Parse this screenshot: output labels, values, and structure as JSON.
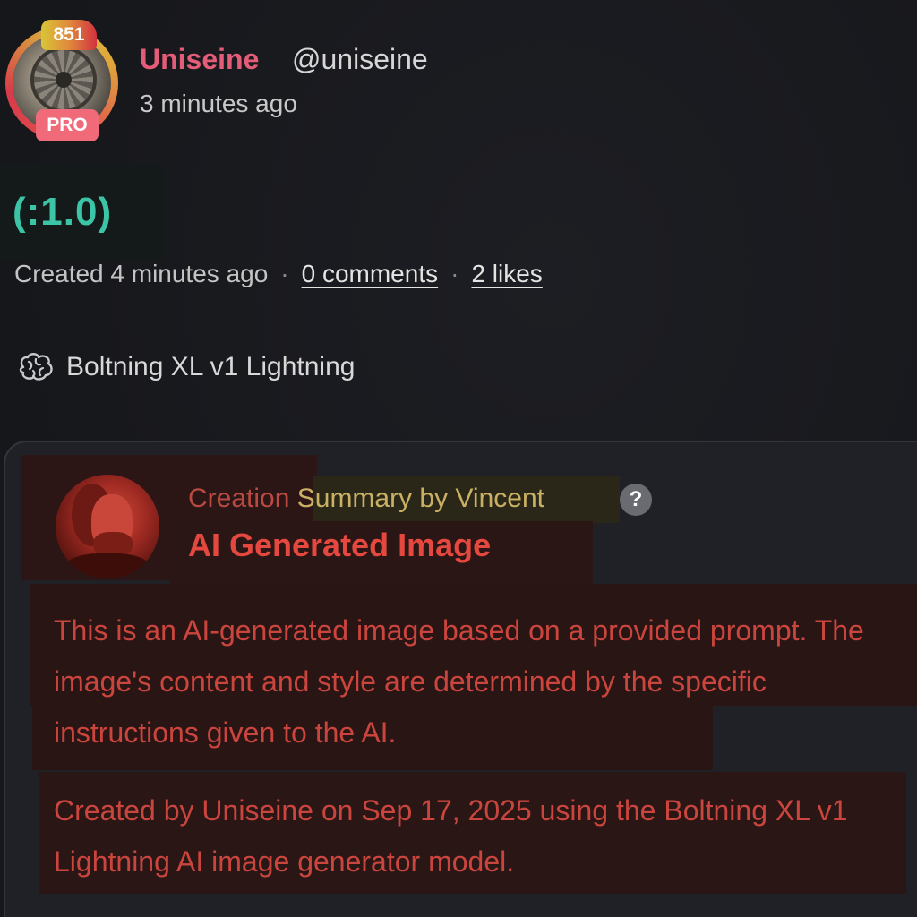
{
  "author": {
    "name": "Uniseine",
    "handle": "@uniseine",
    "time": "3 minutes ago",
    "level": "851",
    "badge": "PRO"
  },
  "post": {
    "strength": "(:1.0)",
    "created": "Created 4 minutes ago",
    "separator": "·",
    "comments": "0 comments",
    "likes": "2 likes"
  },
  "model": {
    "icon": "brain-icon",
    "name": "Boltning XL v1 Lightning"
  },
  "summary": {
    "label_part1": "Creation",
    "label_part2": "Summary by Vincent",
    "help": "?",
    "title": "AI Generated Image",
    "paragraph1": "This is an AI-generated image based on a provided prompt. The image's content and style are determined by the specific instructions given to the AI.",
    "paragraph2": "Created by Uniseine on Sep 17, 2025 using the Boltning XL v1 Lightning AI image generator model."
  },
  "colors": {
    "author_name": "#e35c78",
    "strength": "#3bc4a6",
    "summary_title": "#e5483e",
    "summary_text": "#c9453d",
    "pro_badge": "#f06a7a"
  }
}
